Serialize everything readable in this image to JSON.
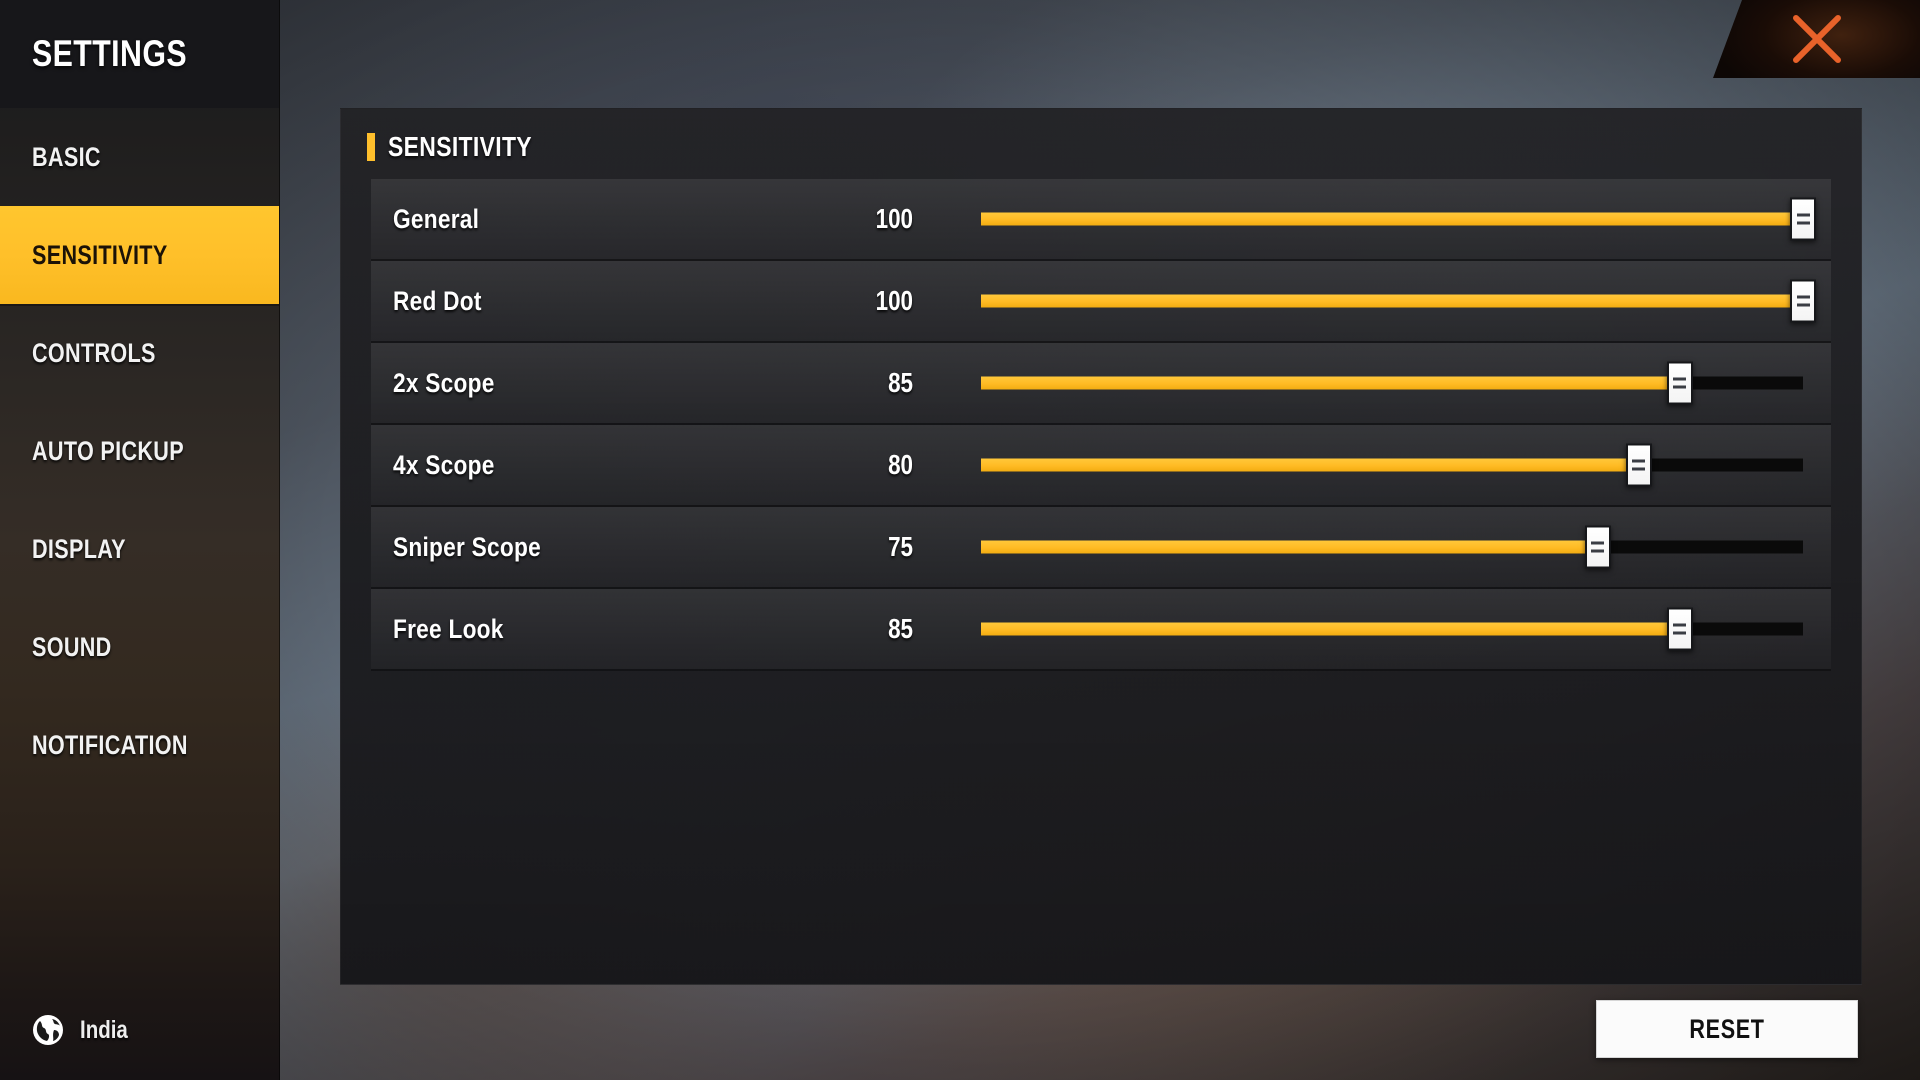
{
  "window": {
    "title": "SETTINGS",
    "close_icon": "close-x-icon",
    "accent_color": "#ffbf2c",
    "close_color": "#e8622a"
  },
  "sidebar": {
    "title": "SETTINGS",
    "items": [
      {
        "label": "BASIC",
        "active": false
      },
      {
        "label": "SENSITIVITY",
        "active": true
      },
      {
        "label": "CONTROLS",
        "active": false
      },
      {
        "label": "AUTO PICKUP",
        "active": false
      },
      {
        "label": "DISPLAY",
        "active": false
      },
      {
        "label": "SOUND",
        "active": false
      },
      {
        "label": "NOTIFICATION",
        "active": false
      }
    ],
    "locale": {
      "icon": "globe-icon",
      "label": "India"
    }
  },
  "main": {
    "section_title": "SENSITIVITY",
    "section_accent": "#ffbf2c",
    "slider_min": 0,
    "slider_max": 100,
    "rows": [
      {
        "label": "General",
        "value": "100",
        "percent": 100
      },
      {
        "label": "Red Dot",
        "value": "100",
        "percent": 100
      },
      {
        "label": "2x Scope",
        "value": "85",
        "percent": 85
      },
      {
        "label": "4x Scope",
        "value": "80",
        "percent": 80
      },
      {
        "label": "Sniper Scope",
        "value": "75",
        "percent": 75
      },
      {
        "label": "Free Look",
        "value": "85",
        "percent": 85
      }
    ]
  },
  "footer": {
    "reset_label": "RESET"
  }
}
